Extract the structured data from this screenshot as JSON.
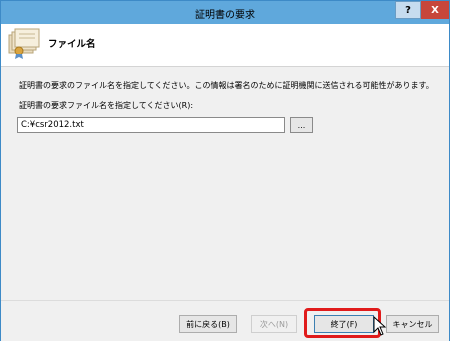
{
  "window": {
    "title": "証明書の要求",
    "help_label": "?",
    "close_label": "X"
  },
  "header": {
    "title": "ファイル名",
    "icon": "certificate-icon"
  },
  "main": {
    "description": "証明書の要求のファイル名を指定してください。この情報は署名のために証明機関に送信される可能性があります。",
    "field_label": "証明書の要求ファイル名を指定してください(R):",
    "field_value": "C:¥csr2012.txt",
    "browse_label": "..."
  },
  "footer": {
    "back_label": "前に戻る(B)",
    "next_label": "次へ(N)",
    "finish_label": "終了(F)",
    "cancel_label": "キャンセル"
  },
  "colors": {
    "titlebar": "#5fa8dc",
    "close_button": "#c7463b",
    "highlight": "#e01b1b"
  }
}
